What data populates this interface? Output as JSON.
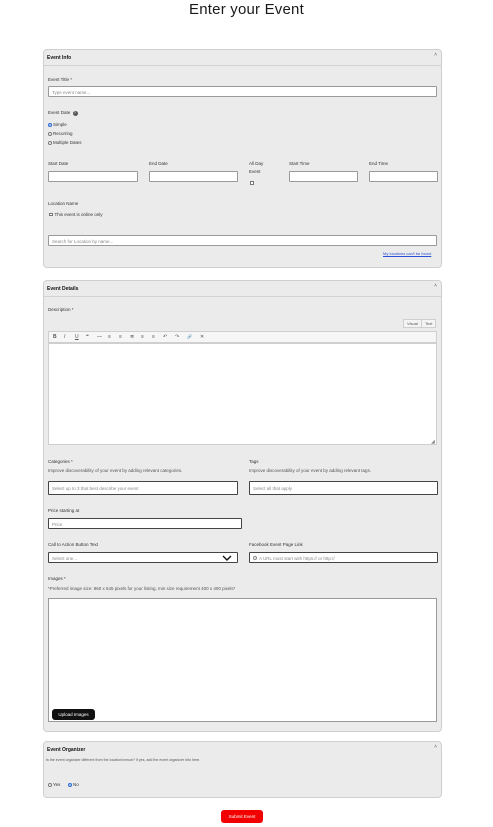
{
  "page": {
    "title": "Enter your Event"
  },
  "event_info": {
    "header": "Event Info",
    "caret": "˄",
    "event_title_label": "Event Title *",
    "event_title_placeholder": "Type event name...",
    "event_date_label": "Event Date",
    "help_icon": "?",
    "date_options": [
      {
        "label": "Simple",
        "selected": true
      },
      {
        "label": "Recurring",
        "selected": false
      },
      {
        "label": "Multiple Dates",
        "selected": false
      }
    ],
    "start_date_label": "Start Date",
    "end_date_label": "End Date",
    "all_day_label_1": "All Day",
    "all_day_label_2": "Event",
    "start_time_label": "Start Time",
    "end_time_label": "End Time",
    "location_label": "Location Name",
    "online_only_label": "This event is online only",
    "location_placeholder": "Search for Location by name...",
    "location_link": "My locations can't be found"
  },
  "event_details": {
    "header": "Event Details",
    "caret": "˄",
    "description_label": "Description *",
    "editor_tabs": [
      "Visual",
      "Text"
    ],
    "toolbar": [
      "B",
      "I",
      "U",
      "❝",
      "—",
      "≡",
      "≡",
      "≣",
      "≡",
      "≡",
      "↶",
      "↷",
      "🔗",
      "✕"
    ],
    "categories_label": "Categories *",
    "categories_help": "Improve discoverability of your event by adding relevant categories.",
    "categories_placeholder": "Select up to 3 that best describe your event",
    "tags_label": "Tags",
    "tags_help": "Improve discoverability of your event by adding relevant tags.",
    "tags_placeholder": "Select all that apply",
    "price_label": "Price starting at",
    "price_placeholder": "Price",
    "cta_label": "Call to Action Button Text",
    "cta_placeholder": "Select one...",
    "facebook_label": "Facebook Event Page Link",
    "facebook_placeholder": "A URL must start with https:// or http://",
    "images_label": "Images *",
    "images_help": "*Preferred image size: 860 x 545 pixels for your listing, min size requirement 400 x 400 pixels*",
    "upload_label": "Upload Images"
  },
  "event_organizer": {
    "header": "Event Organizer",
    "caret": "˄",
    "question": "Is the event organizer different from the location/venue? If yes, add the event organizer info here.",
    "options": [
      {
        "label": "Yes",
        "selected": false
      },
      {
        "label": "No",
        "selected": true
      }
    ]
  },
  "submit": {
    "label": "Submit Event"
  }
}
